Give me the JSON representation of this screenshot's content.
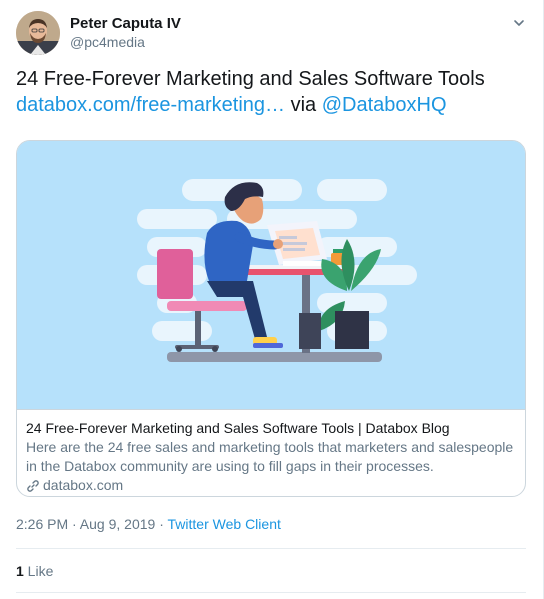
{
  "author": {
    "name": "Peter Caputa IV",
    "handle": "@pc4media",
    "avatar_icon": "person-avatar"
  },
  "tweet": {
    "line1": "24 Free-Forever Marketing and Sales Software Tools",
    "link_text": "databox.com/free-marketing…",
    "via_text": " via ",
    "mention": "@DataboxHQ"
  },
  "card": {
    "image_icon": "person-at-desk-illustration",
    "title": "24 Free-Forever Marketing and Sales Software Tools | Databox Blog",
    "description": "Here are the 24 free sales and marketing tools that marketers and salespeople in the Databox community are using to fill gaps in their processes.",
    "domain": "databox.com",
    "image_bg": "#b6e1fb"
  },
  "meta": {
    "timestamp": "2:26 PM · Aug 9, 2019",
    "separator": " · ",
    "client": "Twitter Web Client"
  },
  "stats": {
    "like_count": "1",
    "like_label": " Like"
  },
  "colors": {
    "link": "#1b95e0",
    "secondary_text": "#657786",
    "border": "#ccd6dd"
  }
}
